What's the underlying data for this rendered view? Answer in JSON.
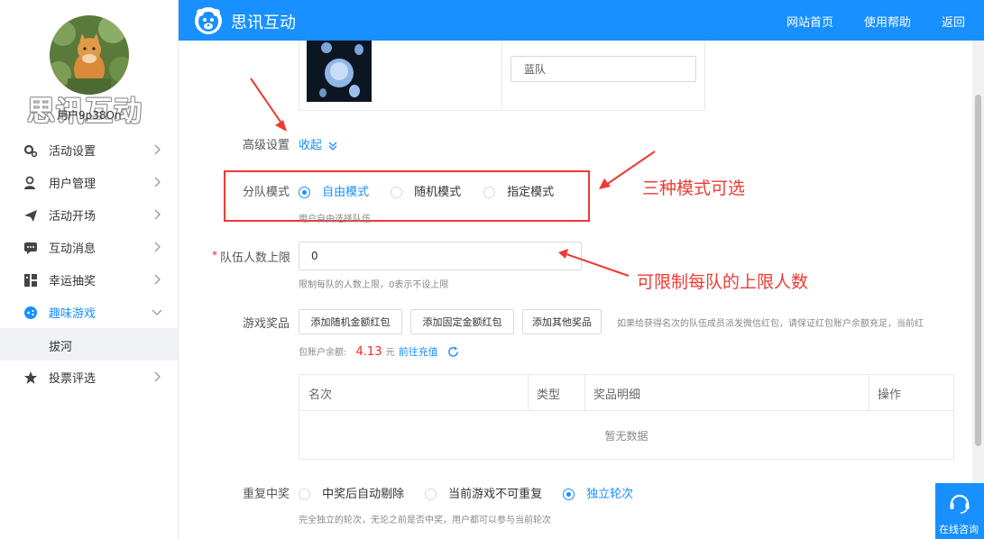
{
  "brand": {
    "name": "思讯互动",
    "watermark": "思讯互动",
    "primary_color": "#1890ff"
  },
  "user": {
    "name": "用户9p38On"
  },
  "header": {
    "nav": [
      "网站首页",
      "使用帮助",
      "返回"
    ]
  },
  "sidebar": {
    "items": [
      {
        "label": "活动设置",
        "icon": "gear-icon"
      },
      {
        "label": "用户管理",
        "icon": "user-icon"
      },
      {
        "label": "活动开场",
        "icon": "paper-plane-icon"
      },
      {
        "label": "互动消息",
        "icon": "message-icon"
      },
      {
        "label": "幸运抽奖",
        "icon": "lottery-icon"
      },
      {
        "label": "趣味游戏",
        "icon": "game-icon"
      },
      {
        "label": "投票评选",
        "icon": "star-icon"
      }
    ],
    "sub_item": "拔河"
  },
  "form": {
    "team_name_value": "蓝队",
    "advanced_label": "高级设置",
    "collapse_label": "收起",
    "team_mode": {
      "label": "分队模式",
      "options": [
        "自由模式",
        "随机模式",
        "指定模式"
      ],
      "selected": "自由模式",
      "hint": "用户自由选择队伍"
    },
    "team_limit": {
      "required_mark": "*",
      "label": "队伍人数上限",
      "value": "0",
      "hint": "限制每队的人数上限，0表示不设上限"
    },
    "prizes": {
      "label": "游戏奖品",
      "buttons": [
        "添加随机金额红包",
        "添加固定金额红包",
        "添加其他奖品"
      ],
      "notice_line1": "如果给获得名次的队伍成员派发微信红包，请保证红包账户余额充足，当前红",
      "notice_line2": "包账户余额:",
      "balance": "4.13",
      "unit": "元",
      "recharge_label": "前往充值"
    },
    "table": {
      "columns": [
        "名次",
        "类型",
        "奖品明细",
        "操作"
      ],
      "empty_text": "暂无数据"
    },
    "repeat": {
      "label": "重复中奖",
      "options": [
        "中奖后自动剔除",
        "当前游戏不可重复",
        "独立轮次"
      ],
      "selected": "独立轮次",
      "hint": "完全独立的轮次，无论之前是否中奖，用户都可以参与当前轮次"
    }
  },
  "annotations": {
    "modes": "三种模式可选",
    "limit": "可限制每队的上限人数",
    "color": "#ee3a33"
  },
  "chat_widget": {
    "label": "在线咨询"
  }
}
